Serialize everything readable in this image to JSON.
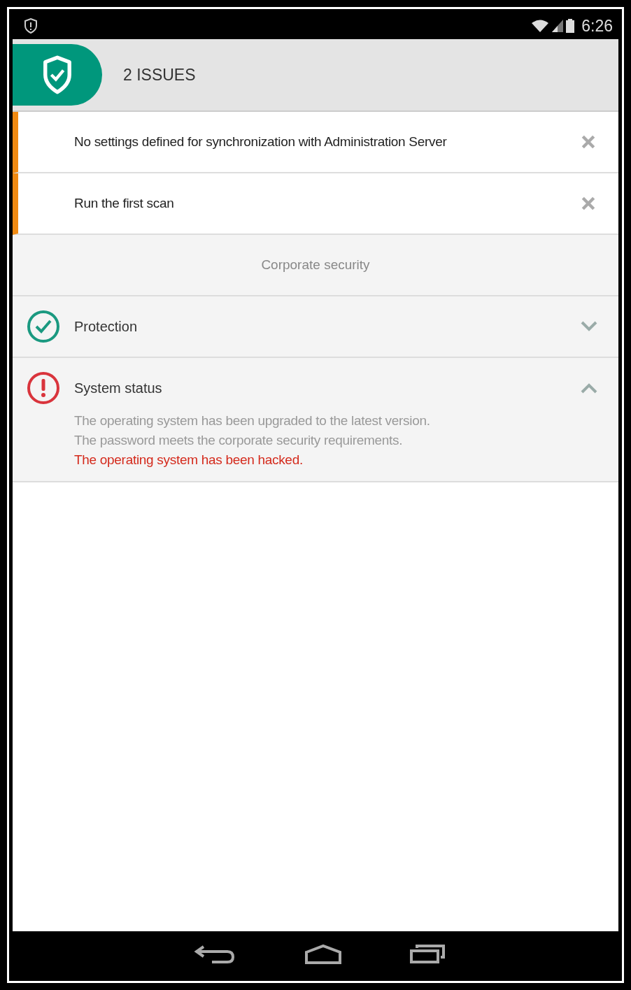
{
  "status_bar": {
    "time": "6:26"
  },
  "header": {
    "title": "2 ISSUES"
  },
  "issues": [
    {
      "text": "No settings defined for synchronization with Administration Server"
    },
    {
      "text": "Run the first scan"
    }
  ],
  "section": {
    "title": "Corporate security"
  },
  "groups": [
    {
      "title": "Protection",
      "kind": "ok",
      "expanded": false
    },
    {
      "title": "System status",
      "kind": "error",
      "expanded": true,
      "details": [
        {
          "text": "The operating system has been upgraded to the latest version.",
          "kind": "normal"
        },
        {
          "text": "The password meets the corporate security requirements.",
          "kind": "normal"
        },
        {
          "text": "The operating system has been hacked.",
          "kind": "alert"
        }
      ]
    }
  ]
}
